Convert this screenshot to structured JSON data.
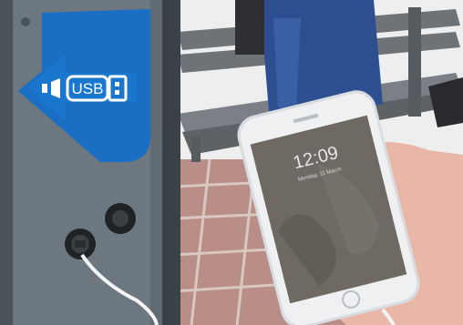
{
  "sign": {
    "label": "USB",
    "colors": {
      "sign_blue": "#1a6fc4",
      "sign_white": "#ffffff"
    }
  },
  "phone": {
    "lock_time": "12:09",
    "lock_date": "Monday, 11 March",
    "colors": {
      "body": "#d9dde2",
      "screen": "#6e6a63"
    }
  },
  "scene_colors": {
    "kiosk": "#6c7780",
    "kiosk_dark": "#3a4248",
    "paving": "#b98e86",
    "snow": "#eeeeee",
    "bench": "#6d7377",
    "coat": "#2e4f8f",
    "skin": "#e9b7a7"
  }
}
